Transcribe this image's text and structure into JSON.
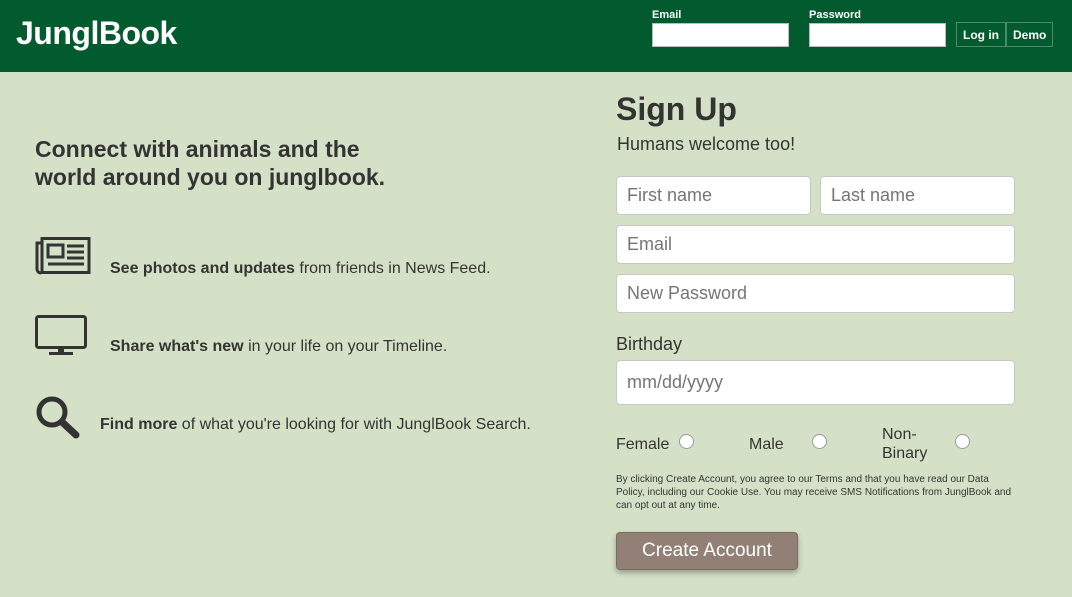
{
  "header": {
    "logo": "JunglBook",
    "email_label": "Email",
    "password_label": "Password",
    "login_button": "Log in",
    "demo_button": "Demo"
  },
  "left": {
    "tagline_line1": "Connect with animals and the",
    "tagline_line2": "world around you on junglbook.",
    "features": [
      {
        "icon": "newspaper-icon",
        "bold": "See photos and updates",
        "rest": " from friends in News Feed."
      },
      {
        "icon": "monitor-icon",
        "bold": "Share what's new",
        "rest": " in your life on your Timeline."
      },
      {
        "icon": "search-icon",
        "bold": "Find more",
        "rest": " of what you're looking for with JunglBook Search."
      }
    ]
  },
  "signup": {
    "title": "Sign Up",
    "subtitle": "Humans welcome too!",
    "first_name_placeholder": "First name",
    "last_name_placeholder": "Last name",
    "email_placeholder": "Email",
    "password_placeholder": "New Password",
    "birthday_label": "Birthday",
    "birthday_placeholder": "mm/dd/yyyy",
    "gender_female": "Female",
    "gender_male": "Male",
    "gender_nonbinary_line1": "Non-",
    "gender_nonbinary_line2": "Binary",
    "terms": "By clicking Create Account, you agree to our Terms and that you have read our Data Policy, including our Cookie Use. You may receive SMS Notifications from JunglBook and can opt out at any time.",
    "create_button": "Create Account"
  },
  "colors": {
    "header_bg": "#025a2f",
    "page_bg": "#d5e1c7",
    "create_button_bg": "#928077"
  }
}
